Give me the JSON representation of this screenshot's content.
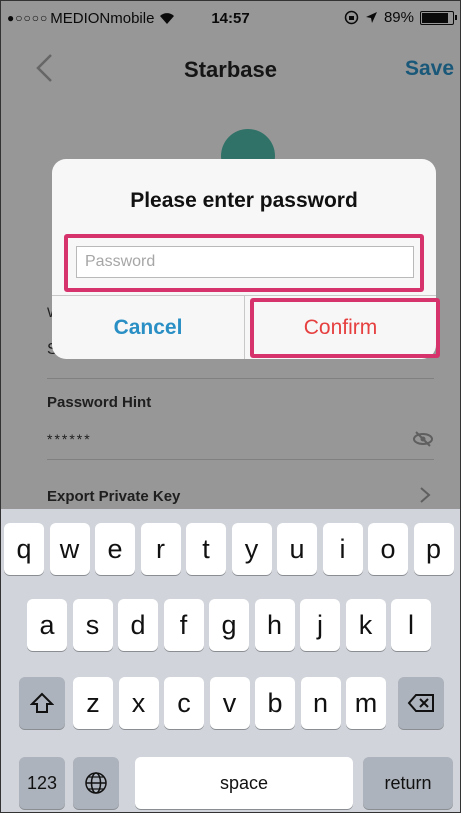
{
  "status_bar": {
    "signal": "●○○○○",
    "carrier": "MEDIONmobile",
    "time": "14:57",
    "battery": "89%",
    "battery_level": 0.89
  },
  "nav": {
    "title": "Starbase",
    "save_label": "Save"
  },
  "background_fields": {
    "wallet_name_partial": "W",
    "wallet_value_partial": "S",
    "password_hint_label": "Password Hint",
    "password_hint_value": "******",
    "export_label": "Export Private Key"
  },
  "dialog": {
    "title": "Please enter password",
    "password_placeholder": "Password",
    "cancel_label": "Cancel",
    "confirm_label": "Confirm"
  },
  "keyboard": {
    "row1": [
      "q",
      "w",
      "e",
      "r",
      "t",
      "y",
      "u",
      "i",
      "o",
      "p"
    ],
    "row2": [
      "a",
      "s",
      "d",
      "f",
      "g",
      "h",
      "j",
      "k",
      "l"
    ],
    "row3": [
      "z",
      "x",
      "c",
      "v",
      "b",
      "n",
      "m"
    ],
    "numbers_label": "123",
    "space_label": "space",
    "return_label": "return"
  },
  "colors": {
    "accent": "#2a8fc4",
    "confirm": "#e64040",
    "highlight": "#d6336c"
  }
}
